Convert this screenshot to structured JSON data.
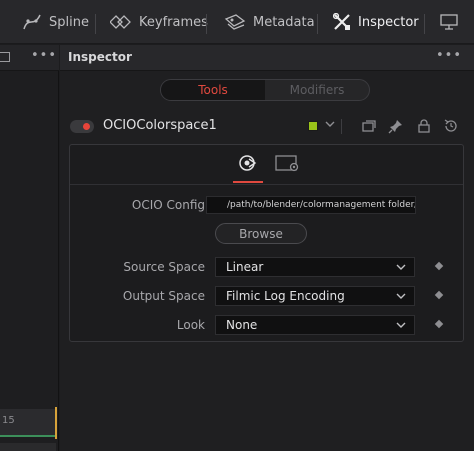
{
  "toolbar": {
    "items": [
      {
        "label": "Spline",
        "icon": "spline-icon"
      },
      {
        "label": "Keyframes",
        "icon": "keyframes-icon"
      },
      {
        "label": "Metadata",
        "icon": "metadata-icon"
      },
      {
        "label": "Inspector",
        "icon": "inspector-icon",
        "active": true
      }
    ]
  },
  "left_panel": {
    "menu": "•••",
    "frame_number": "15"
  },
  "inspector": {
    "title": "Inspector",
    "menu": "•••",
    "tabs": [
      {
        "label": "Tools",
        "active": true
      },
      {
        "label": "Modifiers",
        "active": false
      }
    ],
    "node": {
      "name": "OCIOColorspace1",
      "enabled": true,
      "color": "#9ac31a"
    },
    "fields": {
      "ocio_config_label": "OCIO Config",
      "ocio_config_value": "/path/to/blender/colormanagement folder/config.ocio",
      "browse_label": "Browse",
      "source_space_label": "Source Space",
      "source_space_value": "Linear",
      "output_space_label": "Output Space",
      "output_space_value": "Filmic Log Encoding",
      "look_label": "Look",
      "look_value": "None"
    }
  },
  "colors": {
    "accent": "#e0493f",
    "background": "#1c1c1e",
    "panel": "#28282b"
  }
}
